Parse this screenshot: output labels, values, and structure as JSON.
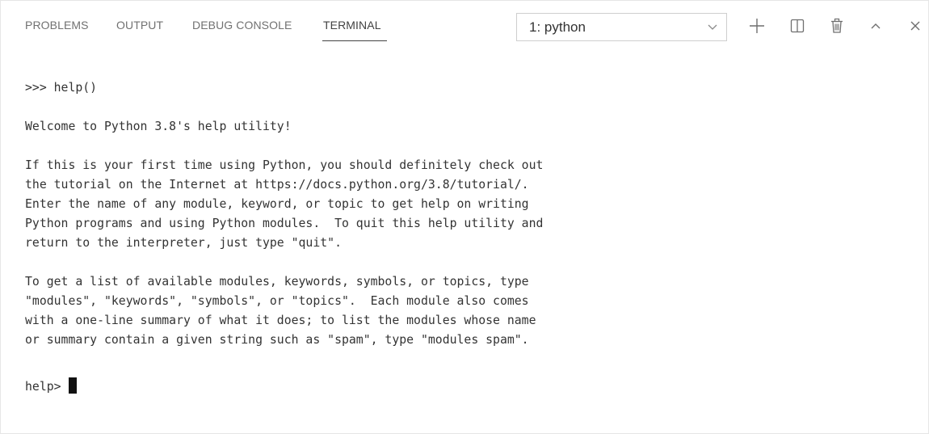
{
  "tabs": {
    "problems": "PROBLEMS",
    "output": "OUTPUT",
    "debug_console": "DEBUG CONSOLE",
    "terminal": "TERMINAL"
  },
  "active_tab": "terminal",
  "terminal_select": {
    "value": "1: python"
  },
  "actions": {
    "new_terminal_icon": "plus-icon",
    "split_icon": "split-icon",
    "kill_icon": "trash-icon",
    "maximize_icon": "chevron-up-icon",
    "close_icon": "close-icon"
  },
  "terminal": {
    "lines": [
      ">>> help()",
      "",
      "Welcome to Python 3.8's help utility!",
      "",
      "If this is your first time using Python, you should definitely check out",
      "the tutorial on the Internet at https://docs.python.org/3.8/tutorial/.",
      "Enter the name of any module, keyword, or topic to get help on writing",
      "Python programs and using Python modules.  To quit this help utility and",
      "return to the interpreter, just type \"quit\".",
      "",
      "To get a list of available modules, keywords, symbols, or topics, type",
      "\"modules\", \"keywords\", \"symbols\", or \"topics\".  Each module also comes",
      "with a one-line summary of what it does; to list the modules whose name",
      "or summary contain a given string such as \"spam\", type \"modules spam\".",
      ""
    ],
    "prompt": "help> "
  },
  "colors": {
    "tab_inactive": "#717171",
    "tab_active": "#424242",
    "text": "#333333",
    "background": "#ffffff"
  }
}
